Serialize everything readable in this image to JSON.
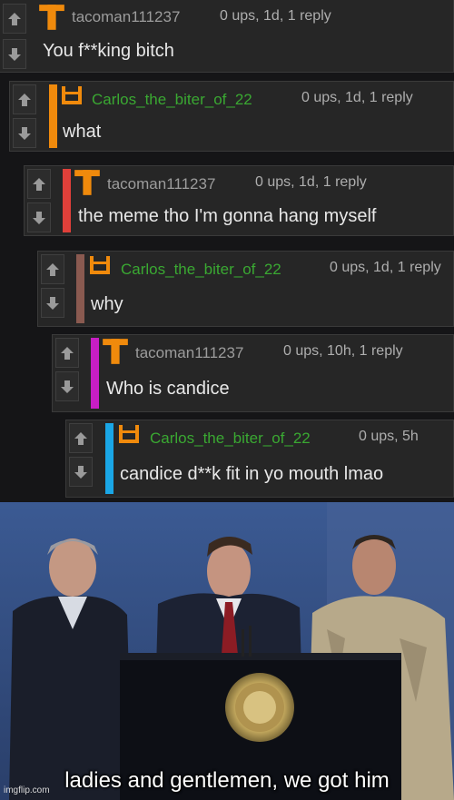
{
  "comments": [
    {
      "user": "tacoman111237",
      "meta": "0 ups, 1d, 1 reply",
      "text": "You f**king bitch",
      "avatar": "t-letter-icon",
      "name_color": "#9c9c9c",
      "bar_color": "none"
    },
    {
      "user": "Carlos_the_biter_of_22",
      "meta": "0 ups, 1d, 1 reply",
      "text": "what",
      "avatar": "face-block-icon",
      "name_color": "#3aa832",
      "bar_color": "#f08a0c"
    },
    {
      "user": "tacoman111237",
      "meta": "0 ups, 1d, 1 reply",
      "text": "the meme tho I'm gonna hang myself",
      "avatar": "t-letter-icon",
      "name_color": "#9c9c9c",
      "bar_color": "#e0403a"
    },
    {
      "user": "Carlos_the_biter_of_22",
      "meta": "0 ups, 1d, 1 reply",
      "text": "why",
      "avatar": "face-block-icon",
      "name_color": "#3aa832",
      "bar_color": "#8a5a50"
    },
    {
      "user": "tacoman111237",
      "meta": "0 ups, 10h, 1 reply",
      "text": "Who is candice",
      "avatar": "t-letter-icon",
      "name_color": "#9c9c9c",
      "bar_color": "#c81ec4"
    },
    {
      "user": "Carlos_the_biter_of_22",
      "meta": "0 ups, 5h",
      "text": "candice d**k fit in yo mouth lmao",
      "avatar": "face-block-icon",
      "name_color": "#3aa832",
      "bar_color": "#1aa6e6"
    }
  ],
  "meme": {
    "caption": "ladies and gentlemen, we got him",
    "watermark": "imgflip.com"
  },
  "colors": {
    "avatar_orange": "#f08a0c",
    "background": "#151517",
    "panel": "#262626"
  }
}
